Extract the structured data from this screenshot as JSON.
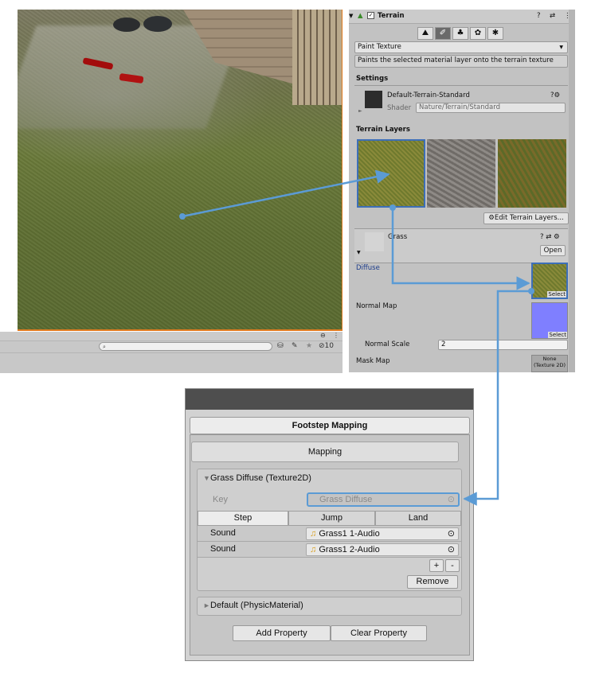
{
  "inspector": {
    "component_title": "Terrain",
    "mode_dropdown": "Paint Texture",
    "mode_description": "Paints the selected material layer onto the terrain texture",
    "settings_label": "Settings",
    "material_name": "Default-Terrain-Standard",
    "shader_label": "Shader",
    "shader_value": "Nature/Terrain/Standard",
    "terrain_layers_label": "Terrain Layers",
    "edit_layers_button": "Edit Terrain Layers...",
    "layer_name": "Grass",
    "open_button": "Open",
    "diffuse_label": "Diffuse",
    "select_label": "Select",
    "normal_map_label": "Normal Map",
    "normal_scale_label": "Normal Scale",
    "normal_scale_value": "2",
    "mask_map_label": "Mask Map",
    "mask_map_value_line1": "None",
    "mask_map_value_line2": "(Texture 2D)"
  },
  "scene_toolbar": {
    "count_label": "10"
  },
  "footstep": {
    "window_title": "Footstep Mapping",
    "mapping_header": "Mapping",
    "grass_group_label": "Grass Diffuse (Texture2D)",
    "key_label": "Key",
    "key_value": "Grass Diffuse",
    "columns": [
      "Step",
      "Jump",
      "Land"
    ],
    "sounds": [
      {
        "label": "Sound",
        "clip": "Grass1 1-Audio"
      },
      {
        "label": "Sound",
        "clip": "Grass1 2-Audio"
      }
    ],
    "plus_button": "+",
    "minus_button": "-",
    "remove_button": "Remove",
    "default_group_label": "Default (PhysicMaterial)",
    "add_property_button": "Add Property",
    "clear_property_button": "Clear Property"
  },
  "colors": {
    "connector": "#5b9bd5",
    "scene_outline": "#e07a1e"
  },
  "icons": {
    "triangle_down": "▼",
    "triangle_right": "►",
    "help": "❓",
    "gear": "⚙",
    "audio": "♫",
    "target": "⊙"
  }
}
